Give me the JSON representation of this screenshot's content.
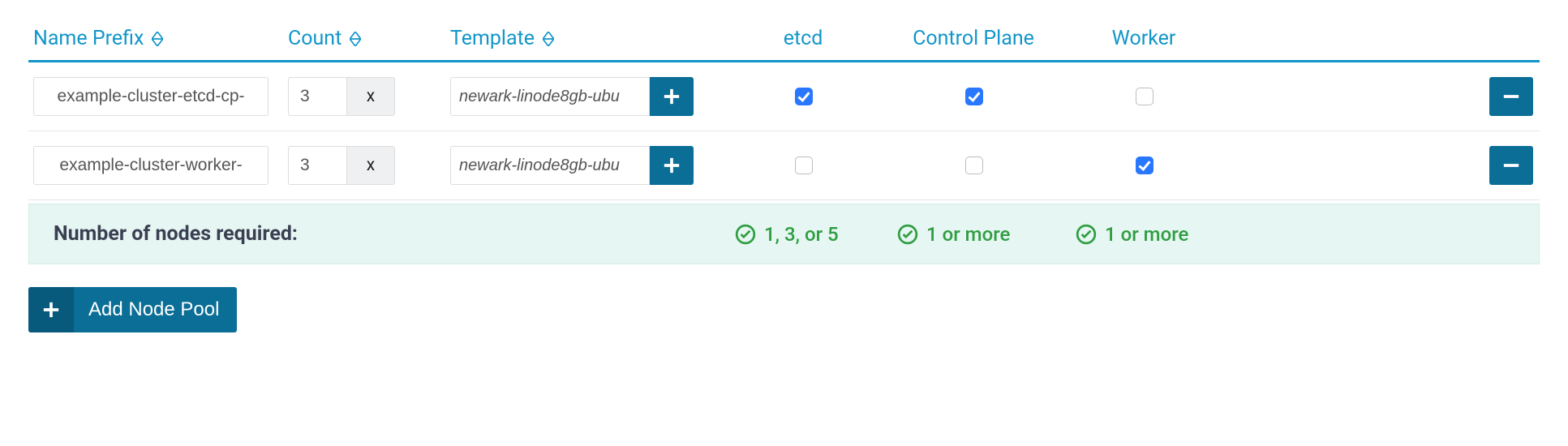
{
  "headers": {
    "name_prefix": "Name Prefix",
    "count": "Count",
    "template": "Template",
    "etcd": "etcd",
    "control_plane": "Control Plane",
    "worker": "Worker"
  },
  "rows": [
    {
      "name_prefix": "example-cluster-etcd-cp-",
      "count": "3",
      "multiply": "x",
      "template": "newark-linode8gb-ubu",
      "etcd": true,
      "control_plane": true,
      "worker": false
    },
    {
      "name_prefix": "example-cluster-worker-",
      "count": "3",
      "multiply": "x",
      "template": "newark-linode8gb-ubu",
      "etcd": false,
      "control_plane": false,
      "worker": true
    }
  ],
  "summary": {
    "label": "Number of nodes required:",
    "etcd": "1, 3, or 5",
    "control_plane": "1 or more",
    "worker": "1 or more"
  },
  "buttons": {
    "add_node_pool": "Add Node Pool"
  }
}
